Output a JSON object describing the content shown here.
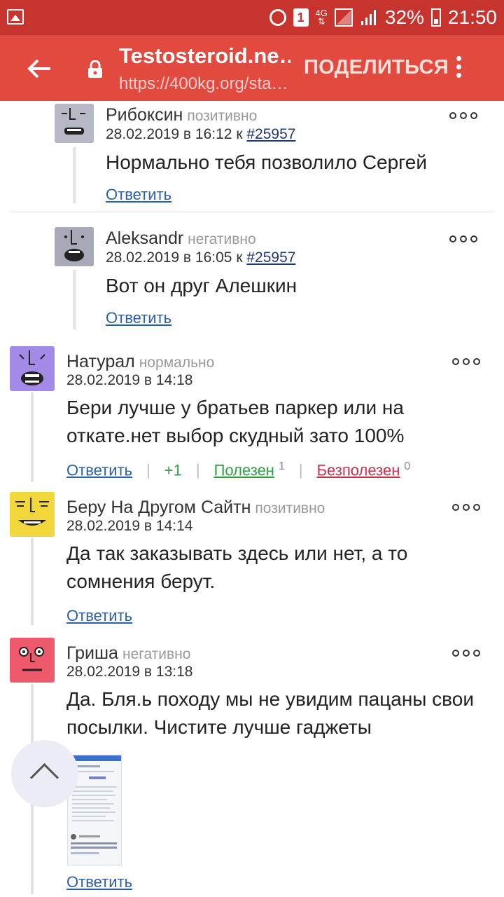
{
  "status_bar": {
    "sim": "1",
    "network": "4G",
    "battery": "32%",
    "time": "21:50"
  },
  "toolbar": {
    "title": "Testosteroid.ne…",
    "url": "https://400kg.org/sta…",
    "share_label": "ПОДЕЛИТЬСЯ",
    "color": "#e2493f"
  },
  "comments": [
    {
      "author": "Рибоксин",
      "rating": "позитивно",
      "meta": "28.02.2019 в 16:12 к",
      "ref": "#25957",
      "text": "Нормально тебя позволило Сергей",
      "reply": "Ответить",
      "avatar_color": "#b6b8c5"
    },
    {
      "author": "Aleksandr",
      "rating": "негативно",
      "meta": "28.02.2019 в 16:05 к",
      "ref": "#25957",
      "text": "Вот он друг Алешкин",
      "reply": "Ответить",
      "avatar_color": "#a7a9b8"
    },
    {
      "author": "Натурал",
      "rating": "нормально",
      "meta": "28.02.2019 в 14:18",
      "text": "Бери лучше у братьев паркер или на откате.нет выбор скудный зато 100%",
      "reply": "Ответить",
      "vote": "+1",
      "useful": "Полезен",
      "useful_count": "1",
      "useless": "Безполезен",
      "useless_count": "0",
      "avatar_color": "#a28ae6"
    },
    {
      "author": "Беру На Другом Сайтн",
      "rating": "позитивно",
      "meta": "28.02.2019 в 14:14",
      "text": "Да так заказывать здесь или нет, а то сомнения берут.",
      "reply": "Ответить",
      "avatar_color": "#f2d73a"
    },
    {
      "author": "Гриша",
      "rating": "негативно",
      "meta": "28.02.2019 в 13:18",
      "text": "Да. Бля.ь походу мы не увидим пацаны свои посылки. Чистите лучше гаджеты",
      "reply": "Ответить",
      "avatar_color": "#ee5a6c"
    }
  ]
}
